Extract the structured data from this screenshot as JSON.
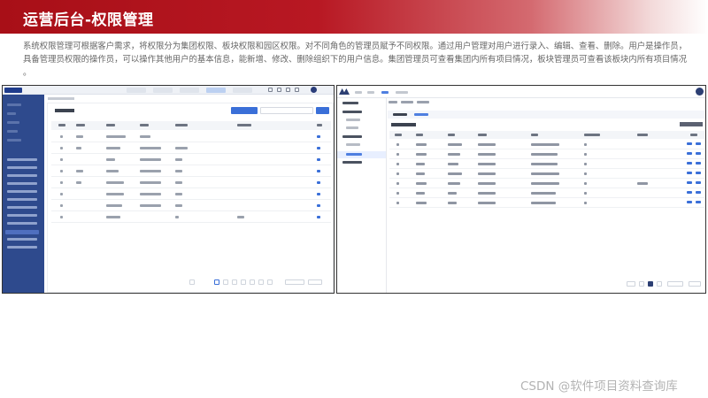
{
  "slide": {
    "title": "运营后台-权限管理",
    "description": "系统权限管理可根据客户需求，将权限分为集团权限、板块权限和园区权限。对不同角色的管理员赋予不同权限。通过用户管理对用户进行录入、编辑、查看、删除。用户是操作员，具备管理员权限的操作员，可以操作其他用户的基本信息，能新增、修改、删除组织下的用户信息。集团管理员可查看集团内所有项目情况，板块管理员可查看该板块内所有项目情况 。",
    "watermark": "CSDN @软件项目资料查询库"
  },
  "colors": {
    "header_red": "#a80f17",
    "sidebar_blue": "#2e4a8d",
    "accent_blue": "#3a6fd8",
    "nav_dark": "#2c3f73"
  }
}
